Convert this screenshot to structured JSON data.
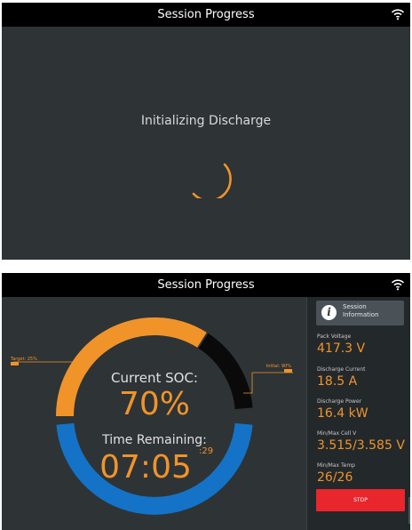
{
  "screen1": {
    "title": "Session Progress",
    "status_text": "Initializing Discharge"
  },
  "screen2": {
    "title": "Session Progress",
    "gauge": {
      "current_soc_label": "Current SOC:",
      "current_soc_value": "70%",
      "current_soc_percent": 70,
      "target_label": "Target: 25%",
      "target_percent": 25,
      "initial_label": "Initial: 90%",
      "initial_percent": 90,
      "time_label": "Time Remaining:",
      "time_value": "07:05",
      "time_seconds": ":29"
    },
    "sidebar": {
      "info_button_label_line1": "Session",
      "info_button_label_line2": "Information",
      "stats": [
        {
          "label": "Pack Voltage",
          "value": "417.3 V"
        },
        {
          "label": "Discharge Current",
          "value": "18.5 A"
        },
        {
          "label": "Discharge Power",
          "value": "16.4 kW"
        },
        {
          "label": "Min/Max Cell V",
          "value": "3.515/3.585 V"
        },
        {
          "label": "Min/Max Temp",
          "value": "26/26"
        }
      ],
      "stop_label": "STOP"
    }
  },
  "colors": {
    "accent_orange": "#f0942a",
    "soc_blue": "#1473c6",
    "stop_red": "#e8262b",
    "screen_bg": "#2e3336",
    "titlebar_bg": "#000000"
  },
  "icons": [
    "wifi-icon",
    "spinner-icon",
    "info-icon"
  ]
}
